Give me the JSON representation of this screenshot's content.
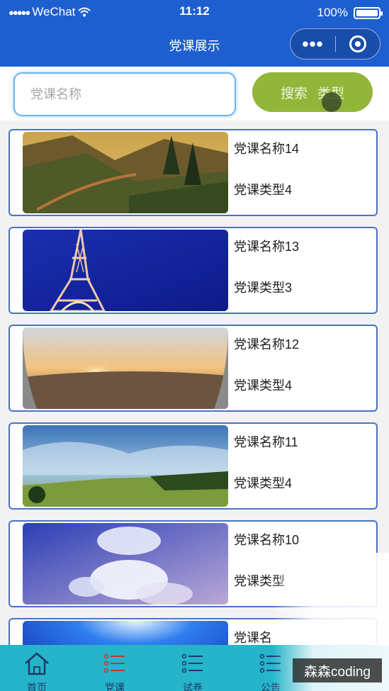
{
  "status_bar": {
    "signal": "●●●●●",
    "carrier": "WeChat",
    "time": "11:12",
    "battery": "100%"
  },
  "nav": {
    "title": "党课展示",
    "more_icon": "•••"
  },
  "search": {
    "placeholder": "党课名称",
    "search_label": "搜索",
    "type_label": "类型"
  },
  "courses": [
    {
      "name": "党课名称14",
      "type": "党课类型4",
      "image": "mountain-valley-forest"
    },
    {
      "name": "党课名称13",
      "type": "党课类型3",
      "image": "eiffel-tower-blue-sky"
    },
    {
      "name": "党课名称12",
      "type": "党课类型4",
      "image": "desert-sunset"
    },
    {
      "name": "党课名称11",
      "type": "党课类型4",
      "image": "mountain-meadow-cloudy-sky"
    },
    {
      "name": "党课名称10",
      "type": "党课类型",
      "image": "anime-clouds-sky"
    },
    {
      "name": "党课名",
      "type": "",
      "image": "bright-blue-sky"
    }
  ],
  "tabs": [
    {
      "label": "首页",
      "icon": "home-icon"
    },
    {
      "label": "党课",
      "icon": "list-icon"
    },
    {
      "label": "试卷",
      "icon": "list-icon"
    },
    {
      "label": "公告",
      "icon": "list-icon"
    }
  ],
  "watermark": "森森coding",
  "colors": {
    "nav": "#1e5fd0",
    "search_button": "#92b63a",
    "card_border": "#4a72c4",
    "tab_bar": "#26b4cb"
  }
}
